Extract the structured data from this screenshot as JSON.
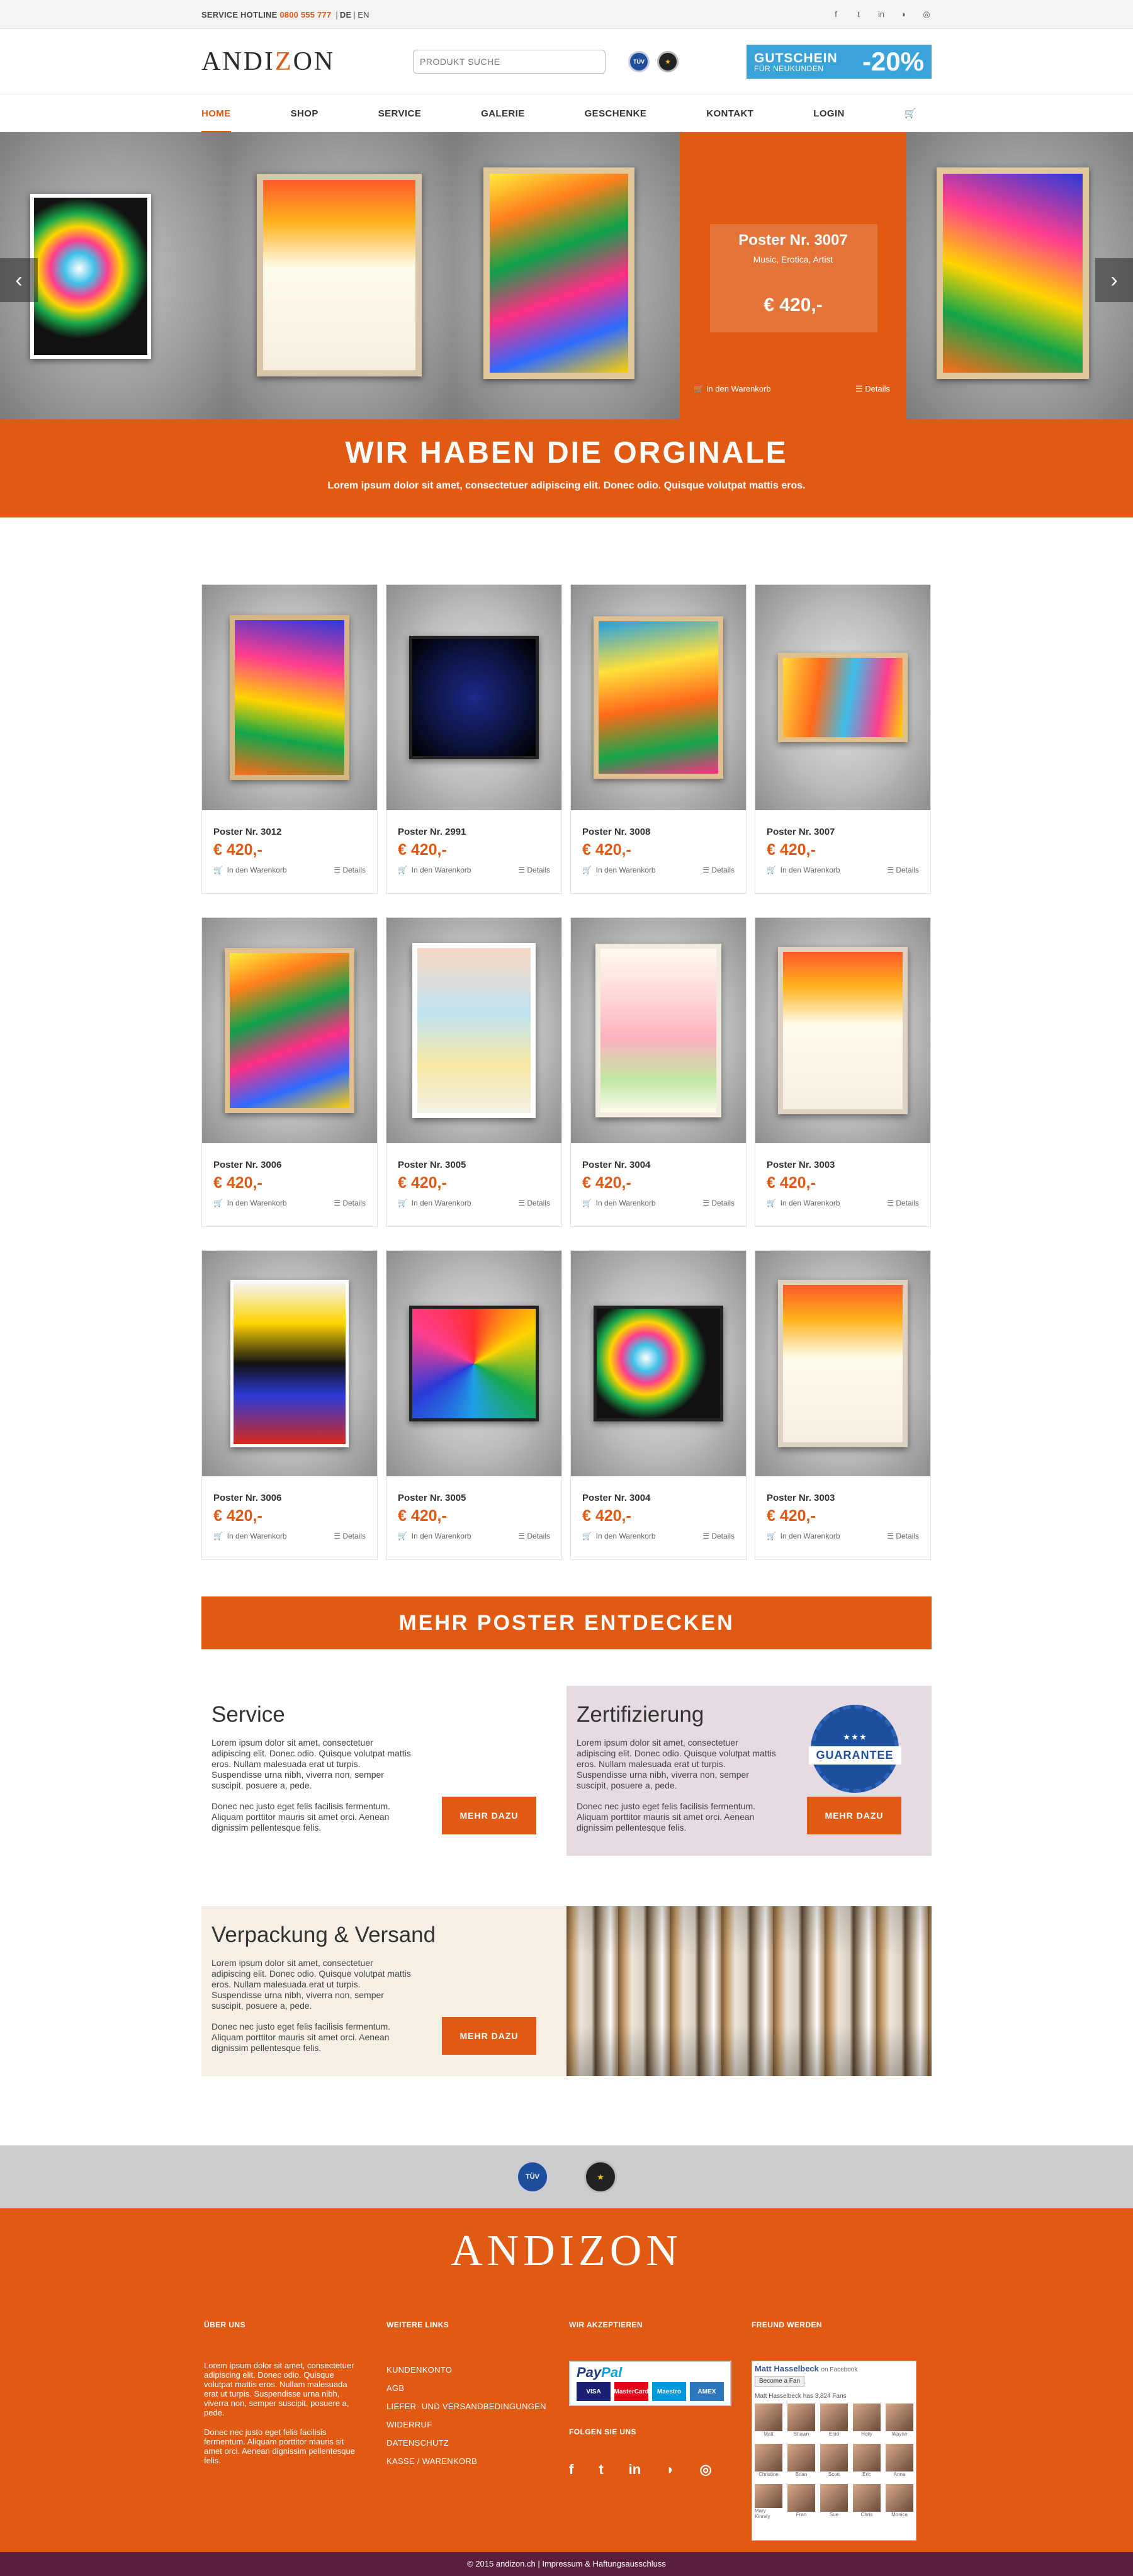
{
  "topbar": {
    "hotline_label": "SERVICE HOTLINE",
    "hotline_number": "0800 555 777",
    "lang_de": "DE",
    "lang_en": "EN",
    "social": [
      "f",
      "t",
      "in",
      "rss",
      "dr"
    ]
  },
  "header": {
    "logo_pre": "ANDI",
    "logo_z": "Z",
    "logo_post": "ON",
    "search_placeholder": "PRODUKT SUCHE",
    "voucher_line1": "GUTSCHEIN",
    "voucher_line2": "FÜR NEUKUNDEN",
    "voucher_discount": "-20%"
  },
  "nav": [
    "HOME",
    "SHOP",
    "SERVICE",
    "GALERIE",
    "GESCHENKE",
    "KONTAKT",
    "LOGIN"
  ],
  "slider": {
    "highlight": {
      "title": "Poster Nr. 3007",
      "subtitle": "Music, Erotica, Artist",
      "price": "€ 420,-",
      "cart": "In den Warenkorb",
      "details": "Details"
    },
    "prev_icon": "chevron-left-icon",
    "next_icon": "chevron-right-icon"
  },
  "banner": {
    "title": "WIR HABEN DIE ORGINALE",
    "text": "Lorem ipsum dolor sit amet, consectetuer adipiscing elit. Donec odio. Quisque volutpat mattis eros."
  },
  "products": [
    {
      "title": "Poster Nr. 3012",
      "price": "€ 420,-"
    },
    {
      "title": "Poster Nr. 2991",
      "price": "€ 420,-"
    },
    {
      "title": "Poster Nr. 3008",
      "price": "€ 420,-"
    },
    {
      "title": "Poster Nr. 3007",
      "price": "€ 420,-"
    },
    {
      "title": "Poster Nr. 3006",
      "price": "€ 420,-"
    },
    {
      "title": "Poster Nr. 3005",
      "price": "€ 420,-"
    },
    {
      "title": "Poster Nr. 3004",
      "price": "€ 420,-"
    },
    {
      "title": "Poster Nr. 3003",
      "price": "€ 420,-"
    },
    {
      "title": "Poster Nr. 3006",
      "price": "€ 420,-"
    },
    {
      "title": "Poster Nr. 3005",
      "price": "€ 420,-"
    },
    {
      "title": "Poster Nr. 3004",
      "price": "€ 420,-"
    },
    {
      "title": "Poster Nr. 3003",
      "price": "€ 420,-"
    }
  ],
  "product_actions": {
    "cart": "In den Warenkorb",
    "details": "Details"
  },
  "more_label": "MEHR POSTER ENTDECKEN",
  "boxes": {
    "service": {
      "title": "Service",
      "p1": "Lorem ipsum dolor sit amet, consectetuer adipiscing elit. Donec odio. Quisque volutpat mattis eros. Nullam malesuada erat ut turpis. Suspendisse urna nibh, viverra non, semper suscipit, posuere a, pede.",
      "p2": "Donec nec justo eget felis facilisis fermentum. Aliquam porttitor mauris sit amet orci. Aenean dignissim pellentesque felis.",
      "button": "MEHR DAZU"
    },
    "zert": {
      "title": "Zertifizierung",
      "p1": "Lorem ipsum dolor sit amet, consectetuer adipiscing elit. Donec odio. Quisque volutpat mattis eros. Nullam malesuada erat ut turpis. Suspendisse urna nibh, viverra non, semper suscipit, posuere a, pede.",
      "p2": "Donec nec justo eget felis facilisis fermentum. Aliquam porttitor mauris sit amet orci. Aenean dignissim pellentesque felis.",
      "button": "MEHR DAZU",
      "badge_text": "GUARANTEE"
    },
    "versand": {
      "title": "Verpackung & Versand",
      "p1": "Lorem ipsum dolor sit amet, consectetuer adipiscing elit. Donec odio. Quisque volutpat mattis eros. Nullam malesuada erat ut turpis. Suspendisse urna nibh, viverra non, semper suscipit, posuere a, pede.",
      "p2": "Donec nec justo eget felis facilisis fermentum. Aliquam porttitor mauris sit amet orci. Aenean dignissim pellentesque felis.",
      "button": "MEHR DAZU"
    }
  },
  "footer": {
    "logo": "ANDIZON",
    "about_title": "ÜBER UNS",
    "about_p1": "Lorem ipsum dolor sit amet, consectetuer adipiscing elit. Donec odio. Quisque volutpat mattis eros. Nullam malesuada erat ut turpis. Suspendisse urna nibh, viverra non, semper suscipit, posuere a, pede.",
    "about_p2": "Donec nec justo eget felis facilisis fermentum. Aliquam porttitor mauris sit amet orci. Aenean dignissim pellentesque felis.",
    "links_title": "WEITERE LINKS",
    "links": [
      "KUNDENKONTO",
      "AGB",
      "LIEFER- UND VERSANDBEDINGUNGEN",
      "WIDERRUF",
      "DATENSCHUTZ",
      "KASSE / WARENKORB"
    ],
    "pay_title": "WIR AKZEPTIEREN",
    "paypal_a": "Pay",
    "paypal_b": "Pal",
    "cards": [
      "VISA",
      "MasterCard",
      "Maestro",
      "AMEX"
    ],
    "follow_title": "FOLGEN SIE UNS",
    "friend_title": "FREUND WERDEN",
    "fb_name": "Matt Hasselbeck",
    "fb_on": "on Facebook",
    "fb_button": "Become a Fan",
    "fb_count": "Matt Hasselbeck has 3,824 Fans",
    "fb_fans": [
      "Matt",
      "Shawn",
      "Enid",
      "Holly",
      "Wayne",
      "Christine",
      "Brian",
      "Scott",
      "Eric",
      "Anna",
      "Mary Kinney",
      "Fran",
      "Sue",
      "Chris",
      "Monica"
    ]
  },
  "copyright": "© 2015 andizon.ch  |  Impressum & Haftungsausschluss"
}
